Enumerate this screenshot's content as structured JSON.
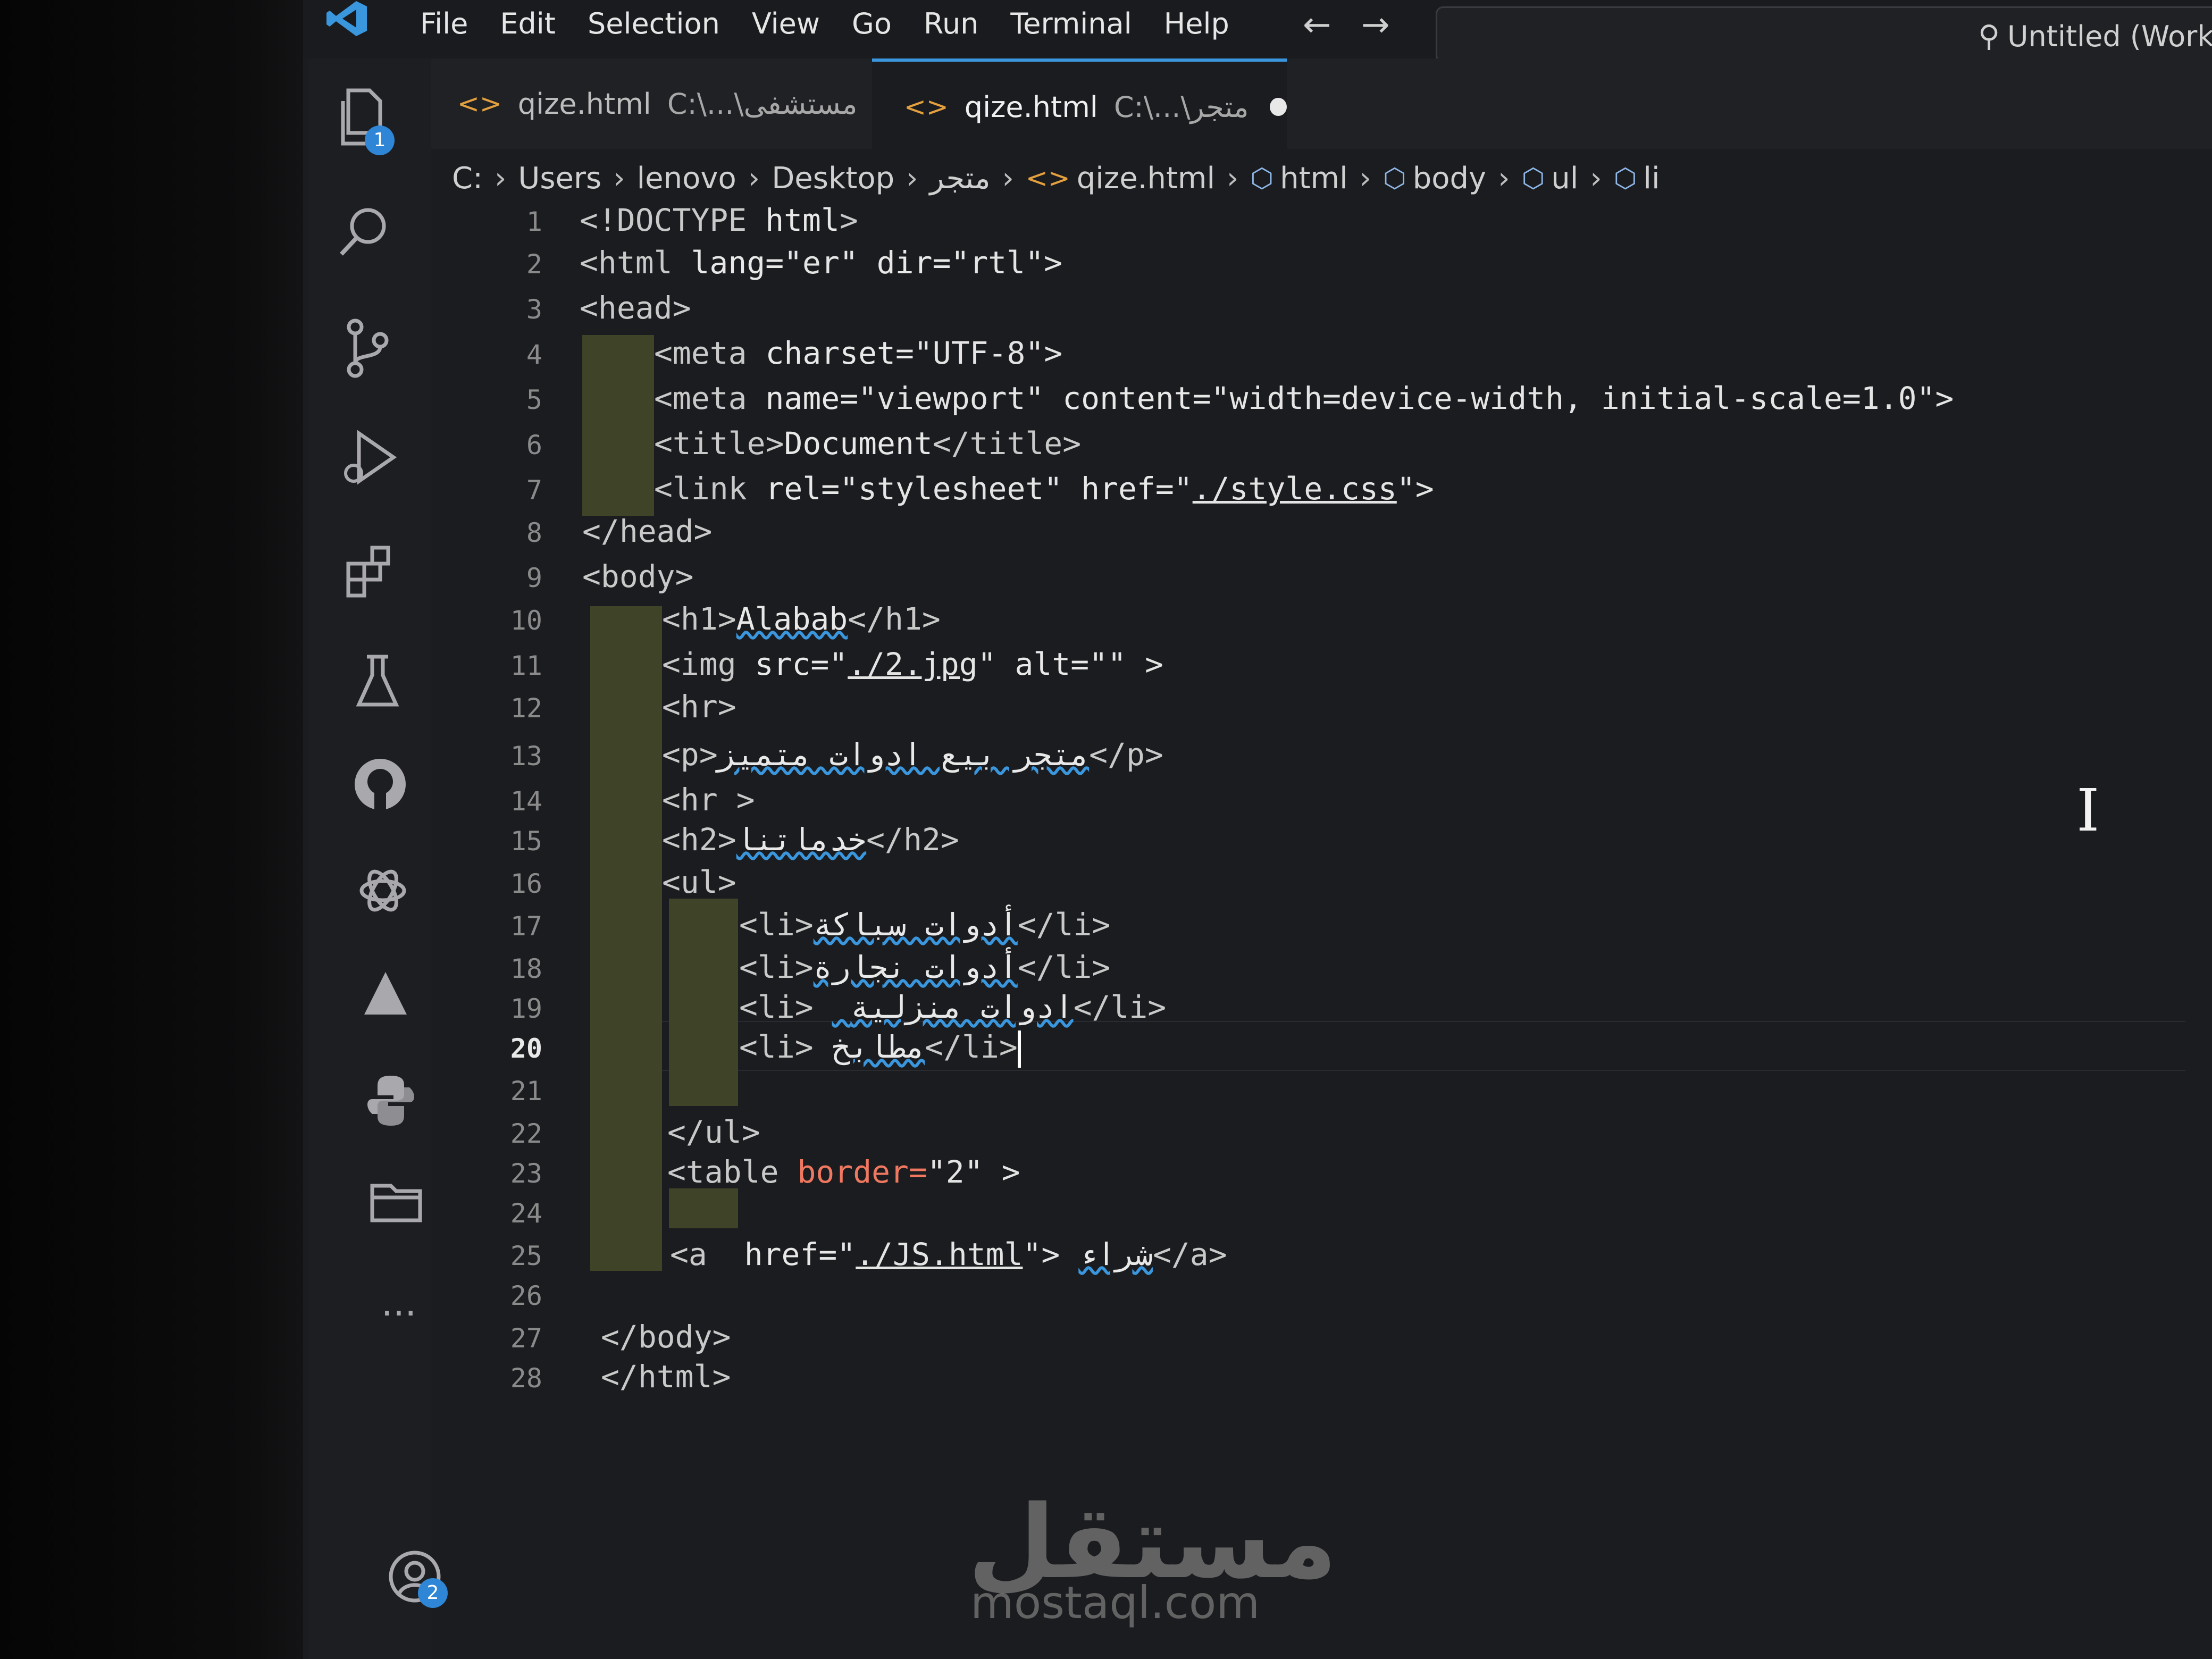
{
  "menu": [
    "File",
    "Edit",
    "Selection",
    "View",
    "Go",
    "Run",
    "Terminal",
    "Help"
  ],
  "command_center": {
    "label": "Untitled (Worksp"
  },
  "activity_bar": {
    "explorer_badge": "1",
    "accounts_badge": "2",
    "more": "..."
  },
  "tabs": [
    {
      "name": "qize.html",
      "path": "C:\\...\\مستشفى",
      "active": false,
      "dirty": false
    },
    {
      "name": "qize.html",
      "path": "C:\\...\\متجر",
      "active": true,
      "dirty": true
    }
  ],
  "breadcrumb": [
    "C:",
    "Users",
    "lenovo",
    "Desktop",
    "متجر",
    "qize.html",
    "html",
    "body",
    "ul",
    "li"
  ],
  "current_line": 20,
  "code_lines": [
    {
      "n": "1",
      "parts": [
        {
          "t": "<!DOCTYPE ",
          "c": "t"
        },
        {
          "t": "html",
          "c": "a"
        },
        {
          "t": ">",
          "c": "t"
        }
      ]
    },
    {
      "n": "2",
      "parts": [
        {
          "t": "<html ",
          "c": "t"
        },
        {
          "t": "lang=",
          "c": "a"
        },
        {
          "t": "\"er\" ",
          "c": "s"
        },
        {
          "t": "dir=",
          "c": "a"
        },
        {
          "t": "\"rtl\">",
          "c": "s"
        }
      ]
    },
    {
      "n": "3",
      "parts": [
        {
          "t": "<head>",
          "c": "t"
        }
      ]
    },
    {
      "n": "4",
      "parts": [
        {
          "t": "<meta ",
          "c": "t"
        },
        {
          "t": "charset=",
          "c": "a"
        },
        {
          "t": "\"UTF-8\">",
          "c": "s"
        }
      ]
    },
    {
      "n": "5",
      "parts": [
        {
          "t": "<meta ",
          "c": "t"
        },
        {
          "t": "name=",
          "c": "a"
        },
        {
          "t": "\"viewport\" ",
          "c": "s"
        },
        {
          "t": "content=",
          "c": "a"
        },
        {
          "t": "\"width=device-width, initial-scale=1.0\">",
          "c": "s"
        }
      ]
    },
    {
      "n": "6",
      "parts": [
        {
          "t": "<title>",
          "c": "t"
        },
        {
          "t": "Document",
          "c": "a"
        },
        {
          "t": "</title>",
          "c": "t"
        }
      ]
    },
    {
      "n": "7",
      "parts": [
        {
          "t": "<link ",
          "c": "t"
        },
        {
          "t": "rel=",
          "c": "a"
        },
        {
          "t": "\"stylesheet\" ",
          "c": "s"
        },
        {
          "t": "href=",
          "c": "a"
        },
        {
          "t": "\"",
          "c": "s"
        },
        {
          "t": "./style.css",
          "c": "s link"
        },
        {
          "t": "\">",
          "c": "s"
        }
      ]
    },
    {
      "n": "8",
      "parts": [
        {
          "t": "</head>",
          "c": "t"
        }
      ]
    },
    {
      "n": "9",
      "parts": [
        {
          "t": "<body>",
          "c": "t"
        }
      ]
    },
    {
      "n": "10",
      "parts": [
        {
          "t": "<h1>",
          "c": "t"
        },
        {
          "t": "Alabab",
          "c": "a squig"
        },
        {
          "t": "</h1>",
          "c": "t"
        }
      ]
    },
    {
      "n": "11",
      "parts": [
        {
          "t": "<img ",
          "c": "t"
        },
        {
          "t": "src=",
          "c": "a"
        },
        {
          "t": "\"",
          "c": "s"
        },
        {
          "t": "./2.jpg",
          "c": "s link"
        },
        {
          "t": "\" ",
          "c": "s"
        },
        {
          "t": "alt=",
          "c": "a"
        },
        {
          "t": "\"\" >",
          "c": "s"
        }
      ]
    },
    {
      "n": "12",
      "parts": [
        {
          "t": "<hr>",
          "c": "t"
        }
      ]
    },
    {
      "n": "13",
      "parts": [
        {
          "t": "<p>",
          "c": "t"
        },
        {
          "t": "متجر بيع ادوات متميز",
          "c": "a squig"
        },
        {
          "t": "</p>",
          "c": "t"
        }
      ]
    },
    {
      "n": "14",
      "parts": [
        {
          "t": "<hr >",
          "c": "t"
        }
      ]
    },
    {
      "n": "15",
      "parts": [
        {
          "t": "<h2>",
          "c": "t"
        },
        {
          "t": "خدماتنا",
          "c": "a squig"
        },
        {
          "t": "</h2>",
          "c": "t"
        }
      ]
    },
    {
      "n": "16",
      "parts": [
        {
          "t": "<ul>",
          "c": "t"
        }
      ]
    },
    {
      "n": "17",
      "parts": [
        {
          "t": "<li>",
          "c": "t"
        },
        {
          "t": "أدوات سباكة",
          "c": "a squig"
        },
        {
          "t": "</li>",
          "c": "t"
        }
      ]
    },
    {
      "n": "18",
      "parts": [
        {
          "t": "<li>",
          "c": "t"
        },
        {
          "t": "أدوات نجارة",
          "c": "a squig"
        },
        {
          "t": "</li>",
          "c": "t"
        }
      ]
    },
    {
      "n": "19",
      "parts": [
        {
          "t": "<li> ",
          "c": "t"
        },
        {
          "t": " ادوات منزلية",
          "c": "a squig"
        },
        {
          "t": "</li>",
          "c": "t"
        }
      ]
    },
    {
      "n": "20",
      "parts": [
        {
          "t": "<li> ",
          "c": "t"
        },
        {
          "t": "مطابخ",
          "c": "a squig"
        },
        {
          "t": "</li>",
          "c": "t"
        }
      ]
    },
    {
      "n": "21",
      "parts": []
    },
    {
      "n": "22",
      "parts": [
        {
          "t": "</ul>",
          "c": "t"
        }
      ]
    },
    {
      "n": "23",
      "parts": [
        {
          "t": "<table ",
          "c": "t"
        },
        {
          "t": "border=",
          "c": "red"
        },
        {
          "t": "\"2\" >",
          "c": "s"
        }
      ]
    },
    {
      "n": "24",
      "parts": []
    },
    {
      "n": "25",
      "parts": [
        {
          "t": "<a  ",
          "c": "t"
        },
        {
          "t": "href=",
          "c": "a"
        },
        {
          "t": "\"",
          "c": "s"
        },
        {
          "t": "./JS.html",
          "c": "s link"
        },
        {
          "t": "\"> ",
          "c": "s"
        },
        {
          "t": "شراء",
          "c": "a squig"
        },
        {
          "t": "</a>",
          "c": "t"
        }
      ]
    },
    {
      "n": "26",
      "parts": []
    },
    {
      "n": "27",
      "parts": [
        {
          "t": "</body>",
          "c": "t"
        }
      ]
    },
    {
      "n": "28",
      "parts": [
        {
          "t": "</html>",
          "c": "t"
        }
      ]
    }
  ],
  "watermark": {
    "logo": "مستقل",
    "site": "mostaql.com"
  }
}
